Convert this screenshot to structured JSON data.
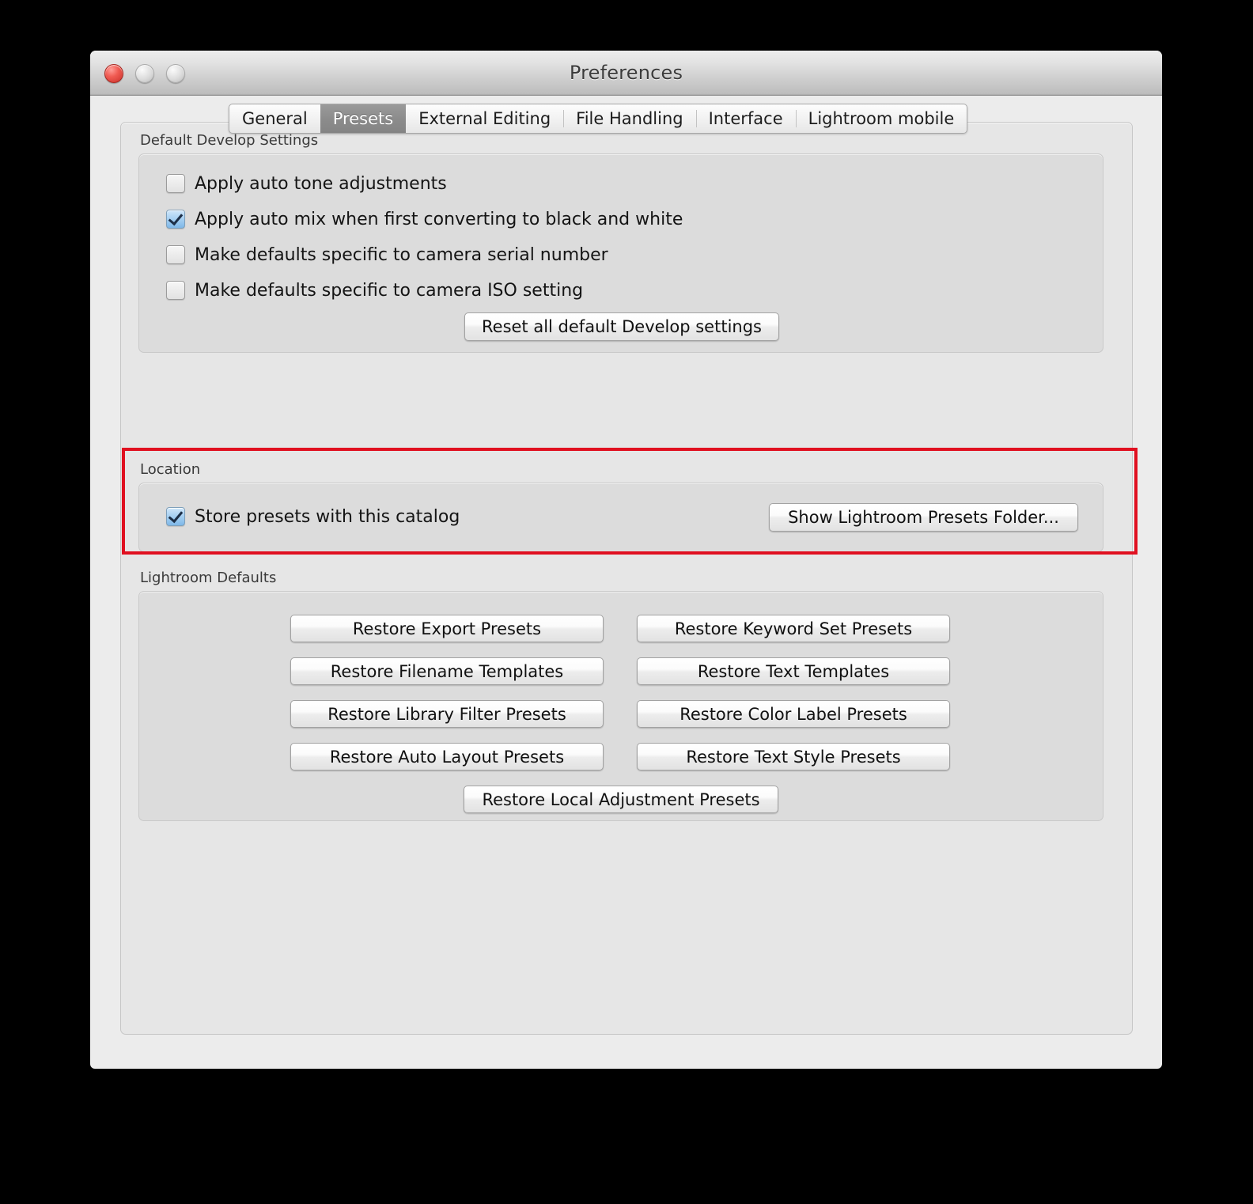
{
  "window": {
    "title": "Preferences",
    "controls": [
      {
        "name": "close",
        "color": "#d0342c"
      },
      {
        "name": "minimize",
        "color": "#cfcfcf"
      },
      {
        "name": "zoom",
        "color": "#cfcfcf"
      }
    ]
  },
  "tabs": [
    {
      "label": "General",
      "selected": false
    },
    {
      "label": "Presets",
      "selected": true
    },
    {
      "label": "External Editing",
      "selected": false
    },
    {
      "label": "File Handling",
      "selected": false
    },
    {
      "label": "Interface",
      "selected": false
    },
    {
      "label": "Lightroom mobile",
      "selected": false
    }
  ],
  "develop": {
    "group_title": "Default Develop Settings",
    "checkboxes": [
      {
        "label": "Apply auto tone adjustments",
        "checked": false
      },
      {
        "label": "Apply auto mix when first converting to black and white",
        "checked": true
      },
      {
        "label": "Make defaults specific to camera serial number",
        "checked": false
      },
      {
        "label": "Make defaults specific to camera ISO setting",
        "checked": false
      }
    ],
    "reset_button": "Reset all default Develop settings"
  },
  "location": {
    "group_title": "Location",
    "store_presets": {
      "label": "Store presets with this catalog",
      "checked": true
    },
    "show_folder_button": "Show Lightroom Presets Folder...",
    "highlight_color": "#e01020"
  },
  "lightroom_defaults": {
    "group_title": "Lightroom Defaults",
    "left_column": [
      "Restore Export Presets",
      "Restore Filename Templates",
      "Restore Library Filter Presets",
      "Restore Auto Layout Presets"
    ],
    "right_column": [
      "Restore Keyword Set Presets",
      "Restore Text Templates",
      "Restore Color Label Presets",
      "Restore Text Style Presets"
    ],
    "bottom_button": "Restore Local Adjustment Presets"
  }
}
